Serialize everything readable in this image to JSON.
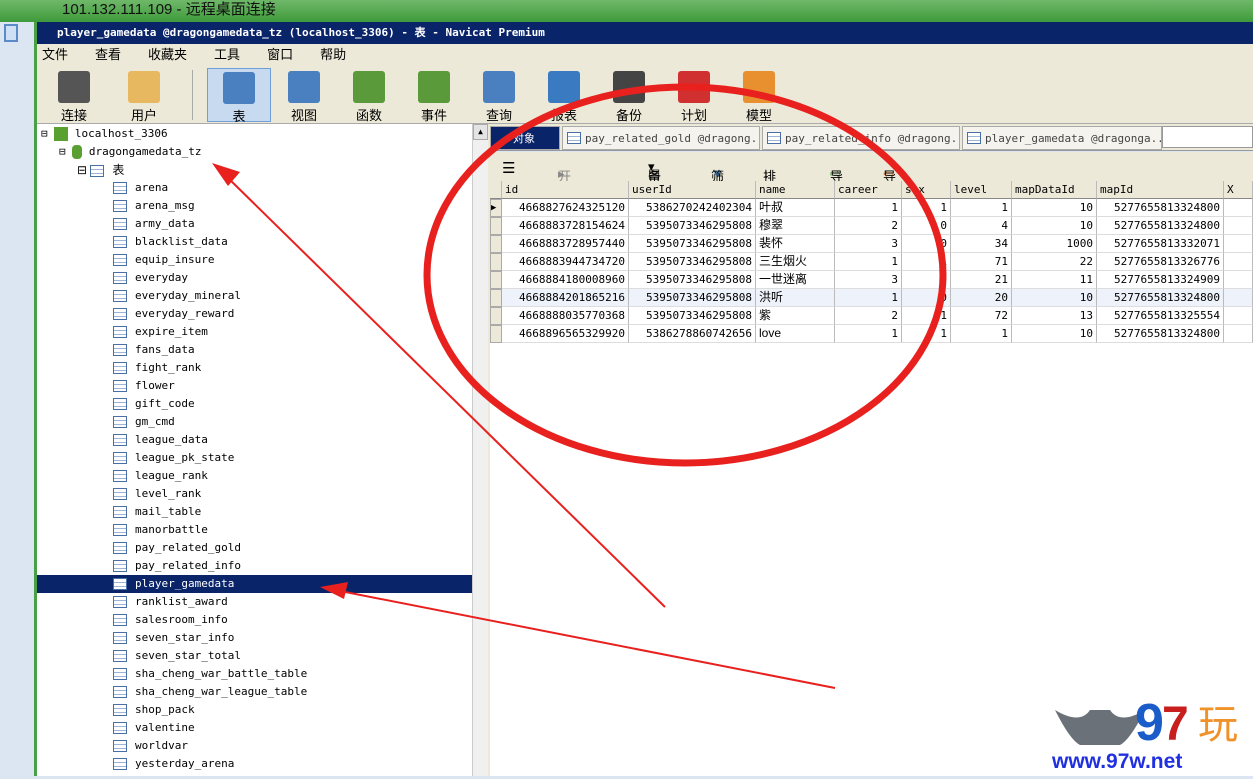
{
  "rdp_title": "101.132.111.109 - 远程桌面连接",
  "window_title": "player_gamedata @dragongamedata_tz (localhost_3306) - 表 - Navicat Premium",
  "menu": [
    "文件",
    "查看",
    "收藏夹",
    "工具",
    "窗口",
    "帮助"
  ],
  "toolbar": [
    {
      "label": "连接",
      "icon": "plug-server-icon",
      "color": "#555555"
    },
    {
      "label": "用户",
      "icon": "user-icon",
      "color": "#e8b860"
    },
    {
      "label": "表",
      "icon": "table-icon",
      "color": "#4a7fc0",
      "selected": true
    },
    {
      "label": "视图",
      "icon": "view-glasses-icon",
      "color": "#4a7fc0"
    },
    {
      "label": "函数",
      "icon": "function-icon",
      "color": "#5a9a3a"
    },
    {
      "label": "事件",
      "icon": "event-clock-icon",
      "color": "#5a9a3a"
    },
    {
      "label": "查询",
      "icon": "query-icon",
      "color": "#4a7fc0"
    },
    {
      "label": "报表",
      "icon": "report-icon",
      "color": "#3a7ac0"
    },
    {
      "label": "备份",
      "icon": "backup-tape-icon",
      "color": "#444444"
    },
    {
      "label": "计划",
      "icon": "schedule-calendar-icon",
      "color": "#d03030"
    },
    {
      "label": "模型",
      "icon": "model-icon",
      "color": "#e89030"
    }
  ],
  "tree": {
    "connection": "localhost_3306",
    "database": "dragongamedata_tz",
    "tables_node": "表",
    "tables": [
      "arena",
      "arena_msg",
      "army_data",
      "blacklist_data",
      "equip_insure",
      "everyday",
      "everyday_mineral",
      "everyday_reward",
      "expire_item",
      "fans_data",
      "fight_rank",
      "flower",
      "gift_code",
      "gm_cmd",
      "league_data",
      "league_pk_state",
      "league_rank",
      "level_rank",
      "mail_table",
      "manorbattle",
      "pay_related_gold",
      "pay_related_info",
      "player_gamedata",
      "ranklist_award",
      "salesroom_info",
      "seven_star_info",
      "seven_star_total",
      "sha_cheng_war_battle_table",
      "sha_cheng_war_league_table",
      "shop_pack",
      "valentine",
      "worldvar",
      "yesterday_arena"
    ],
    "selected": "player_gamedata"
  },
  "tabs": [
    "对象",
    "pay_related_gold @dragong...",
    "pay_related_info @dragong...",
    "player_gamedata @dragonga..."
  ],
  "subtoolbar": {
    "begin_tx": "开始事务",
    "memo": "备注",
    "filter": "筛选",
    "sort": "排序",
    "import": "导入",
    "export": "导出"
  },
  "grid": {
    "columns": [
      "id",
      "userId",
      "name",
      "career",
      "sex",
      "level",
      "mapDataId",
      "mapId",
      "X"
    ],
    "rows": [
      [
        "4668827624325120",
        "5386270242402304",
        "叶叔",
        "1",
        "1",
        "1",
        "10",
        "5277655813324800"
      ],
      [
        "4668883728154624",
        "5395073346295808",
        "穆翠",
        "2",
        "0",
        "4",
        "10",
        "5277655813324800"
      ],
      [
        "4668883728957440",
        "5395073346295808",
        "裴怀",
        "3",
        "0",
        "34",
        "1000",
        "5277655813332071"
      ],
      [
        "4668883944734720",
        "5395073346295808",
        "三生烟火",
        "1",
        "1",
        "71",
        "22",
        "5277655813326776"
      ],
      [
        "4668884180008960",
        "5395073346295808",
        "一世迷离",
        "3",
        "0",
        "21",
        "11",
        "5277655813324909"
      ],
      [
        "4668884201865216",
        "5395073346295808",
        "洪听",
        "1",
        "0",
        "20",
        "10",
        "5277655813324800"
      ],
      [
        "4668888035770368",
        "5395073346295808",
        "紫",
        "2",
        "1",
        "72",
        "13",
        "5277655813325554"
      ],
      [
        "4668896565329920",
        "5386278860742656",
        "love",
        "1",
        "1",
        "1",
        "10",
        "5277655813324800"
      ]
    ]
  },
  "watermark": {
    "brand": "97玩",
    "url": "www.97w.net"
  },
  "annotation_color": "#e8201e"
}
